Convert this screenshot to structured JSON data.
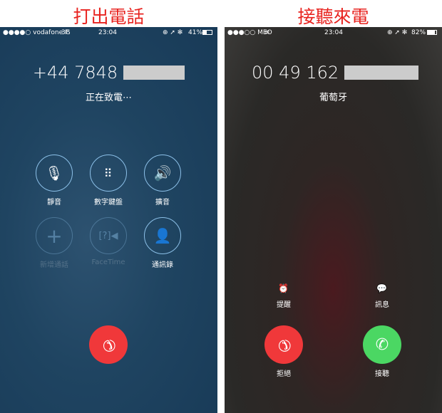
{
  "titles": {
    "outgoing": "打出電話",
    "incoming": "接聽來電"
  },
  "outgoing": {
    "status": {
      "carrier": "●●●●○ vodafone P",
      "network": "3G",
      "time": "23:04",
      "icons": "⊕ ➚ ✻",
      "battery": "41%"
    },
    "number": "+44 7848",
    "state": "正在致電⋯",
    "buttons": [
      {
        "label": "靜音",
        "icon": "mic-off-icon"
      },
      {
        "label": "數字鍵盤",
        "icon": "keypad-icon"
      },
      {
        "label": "擴音",
        "icon": "speaker-icon"
      },
      {
        "label": "新增通話",
        "icon": "plus-icon"
      },
      {
        "label": "FaceTime",
        "icon": "facetime-icon"
      },
      {
        "label": "通訊錄",
        "icon": "contacts-icon"
      }
    ]
  },
  "incoming": {
    "status": {
      "carrier": "●●●○○ MEO",
      "time": "23:04",
      "icons": "⊕ ➚ ✻",
      "battery": "82%"
    },
    "number": "00 49 162",
    "location": "葡萄牙",
    "remind": "提醒",
    "message": "訊息",
    "decline": "拒絕",
    "accept": "接聽"
  }
}
